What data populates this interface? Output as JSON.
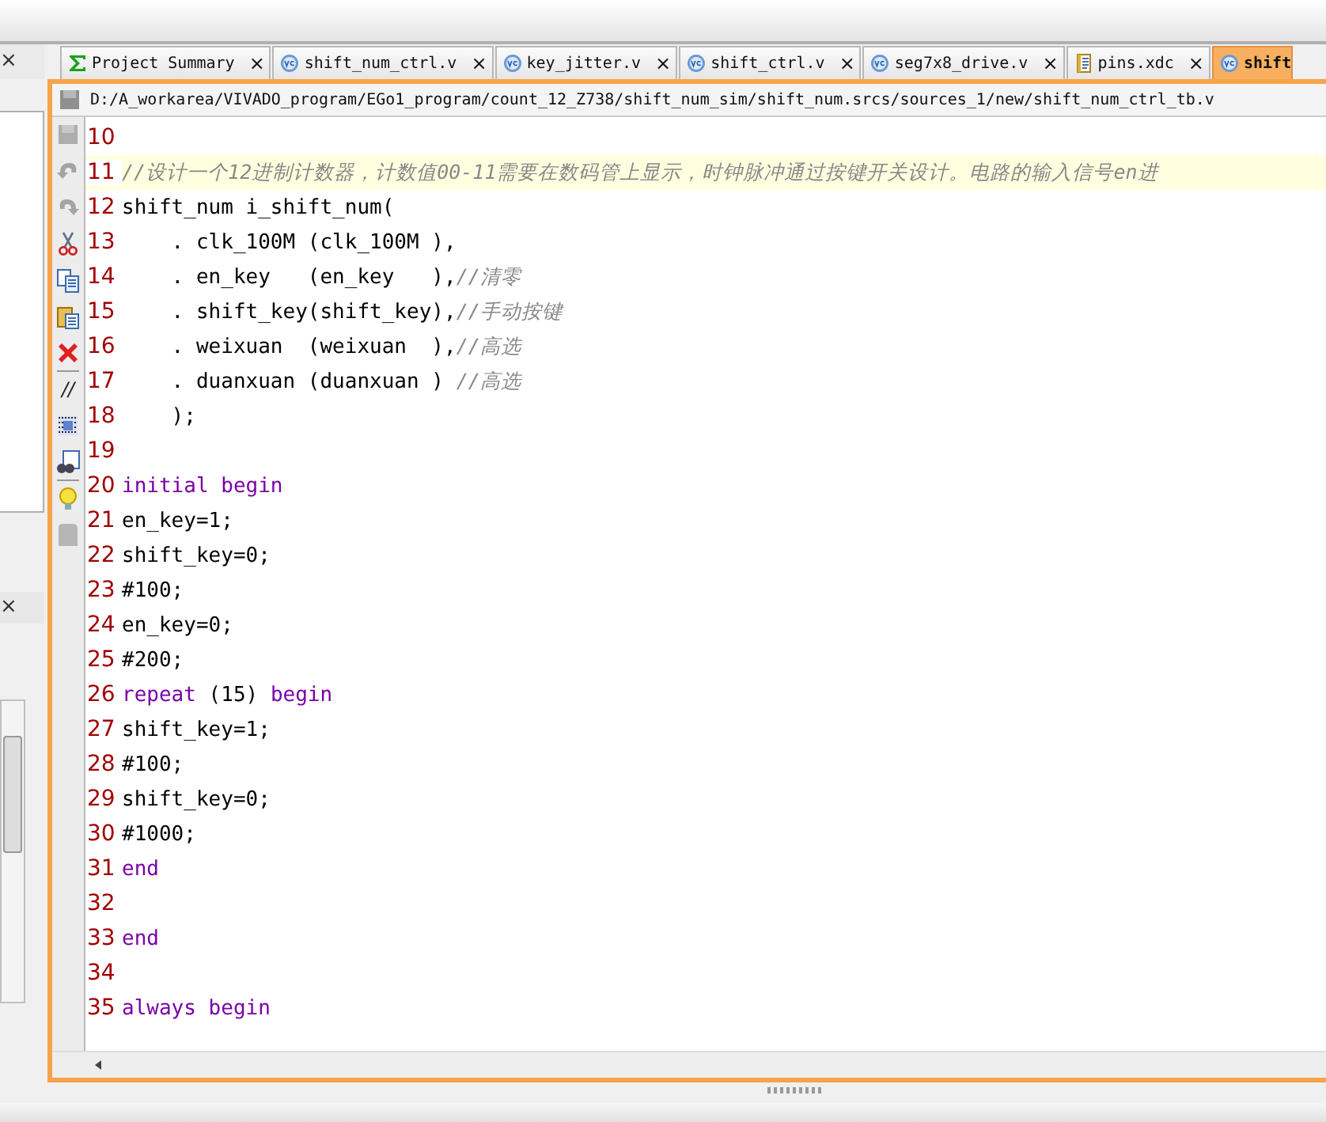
{
  "left_panel": {
    "close_buttons": [
      "×",
      "×"
    ]
  },
  "tabs": [
    {
      "label": "Project Summary",
      "kind": "summary",
      "selected": false,
      "close": "×"
    },
    {
      "label": "shift_num_ctrl.v",
      "kind": "verilog",
      "selected": false,
      "close": "×"
    },
    {
      "label": "key_jitter.v",
      "kind": "verilog",
      "selected": false,
      "close": "×"
    },
    {
      "label": "shift_ctrl.v",
      "kind": "verilog",
      "selected": false,
      "close": "×"
    },
    {
      "label": "seg7x8_drive.v",
      "kind": "verilog",
      "selected": false,
      "close": "×"
    },
    {
      "label": "pins.xdc",
      "kind": "constraints",
      "selected": false,
      "close": "×"
    },
    {
      "label": "shift",
      "kind": "verilog",
      "selected": true
    }
  ],
  "path": "D:/A_workarea/VIVADO_program/EGo1_program/count_12_Z738/shift_num_sim/shift_num.srcs/sources_1/new/shift_num_ctrl_tb.v",
  "toolbar": [
    {
      "kind": "save",
      "disabled": true
    },
    {
      "kind": "undo",
      "disabled": true
    },
    {
      "kind": "redo",
      "disabled": true
    },
    {
      "kind": "cut",
      "disabled": false
    },
    {
      "kind": "copy",
      "disabled": false
    },
    {
      "kind": "paste",
      "disabled": false
    },
    {
      "kind": "delete",
      "disabled": false
    },
    {
      "kind": "comment",
      "label": "//",
      "disabled": false
    },
    {
      "kind": "block",
      "disabled": false
    },
    {
      "kind": "find",
      "disabled": false
    },
    {
      "kind": "hint",
      "disabled": false
    },
    {
      "kind": "stamp",
      "disabled": true
    }
  ],
  "lines": [
    {
      "number": "10",
      "highlighted": false
    },
    {
      "number": "11",
      "highlighted": true,
      "tokens": [
        {
          "text": "//设计一个12进制计数器，计数值00-11需要在数码管上显示，时钟脉冲通过按键开关设计。电路的输入信号en进",
          "kind": "comment"
        }
      ]
    },
    {
      "number": "12",
      "highlighted": false,
      "tokens": [
        {
          "text": "shift_num i_shift_num(",
          "kind": "plain"
        }
      ]
    },
    {
      "number": "13",
      "highlighted": false,
      "tokens": [
        {
          "text": "    . clk_100M (clk_100M ),",
          "kind": "plain"
        }
      ]
    },
    {
      "number": "14",
      "highlighted": false,
      "tokens": [
        {
          "text": "    . en_key   (en_key   ),",
          "kind": "plain"
        },
        {
          "text": "//清零",
          "kind": "comment"
        }
      ]
    },
    {
      "number": "15",
      "highlighted": false,
      "tokens": [
        {
          "text": "    . shift_key(shift_key),",
          "kind": "plain"
        },
        {
          "text": "//手动按键",
          "kind": "comment"
        }
      ]
    },
    {
      "number": "16",
      "highlighted": false,
      "tokens": [
        {
          "text": "    . weixuan  (weixuan  ),",
          "kind": "plain"
        },
        {
          "text": "//高选",
          "kind": "comment"
        }
      ]
    },
    {
      "number": "17",
      "highlighted": false,
      "tokens": [
        {
          "text": "    . duanxuan (duanxuan ) ",
          "kind": "plain"
        },
        {
          "text": "//高选",
          "kind": "comment"
        }
      ]
    },
    {
      "number": "18",
      "highlighted": false,
      "tokens": [
        {
          "text": "    );",
          "kind": "plain"
        }
      ]
    },
    {
      "number": "19",
      "highlighted": false
    },
    {
      "number": "20",
      "highlighted": false,
      "tokens": [
        {
          "text": "initial begin",
          "kind": "keyword"
        }
      ]
    },
    {
      "number": "21",
      "highlighted": false,
      "tokens": [
        {
          "text": "en_key=1;",
          "kind": "plain"
        }
      ]
    },
    {
      "number": "22",
      "highlighted": false,
      "tokens": [
        {
          "text": "shift_key=0;",
          "kind": "plain"
        }
      ]
    },
    {
      "number": "23",
      "highlighted": false,
      "tokens": [
        {
          "text": "#100;",
          "kind": "plain"
        }
      ]
    },
    {
      "number": "24",
      "highlighted": false,
      "tokens": [
        {
          "text": "en_key=0;",
          "kind": "plain"
        }
      ]
    },
    {
      "number": "25",
      "highlighted": false,
      "tokens": [
        {
          "text": "#200;",
          "kind": "plain"
        }
      ]
    },
    {
      "number": "26",
      "highlighted": false,
      "tokens": [
        {
          "text": "repeat",
          "kind": "keyword"
        },
        {
          "text": " (15) ",
          "kind": "plain"
        },
        {
          "text": "begin",
          "kind": "keyword"
        }
      ]
    },
    {
      "number": "27",
      "highlighted": false,
      "tokens": [
        {
          "text": "shift_key=1;",
          "kind": "plain"
        }
      ]
    },
    {
      "number": "28",
      "highlighted": false,
      "tokens": [
        {
          "text": "#100;",
          "kind": "plain"
        }
      ]
    },
    {
      "number": "29",
      "highlighted": false,
      "tokens": [
        {
          "text": "shift_key=0;",
          "kind": "plain"
        }
      ]
    },
    {
      "number": "30",
      "highlighted": false,
      "tokens": [
        {
          "text": "#1000;",
          "kind": "plain"
        }
      ]
    },
    {
      "number": "31",
      "highlighted": false,
      "tokens": [
        {
          "text": "end",
          "kind": "keyword"
        }
      ]
    },
    {
      "number": "32",
      "highlighted": false
    },
    {
      "number": "33",
      "highlighted": false,
      "tokens": [
        {
          "text": "end",
          "kind": "keyword"
        }
      ]
    },
    {
      "number": "34",
      "highlighted": false
    },
    {
      "number": "35",
      "highlighted": false,
      "tokens": [
        {
          "text": "always begin",
          "kind": "keyword"
        }
      ]
    }
  ]
}
